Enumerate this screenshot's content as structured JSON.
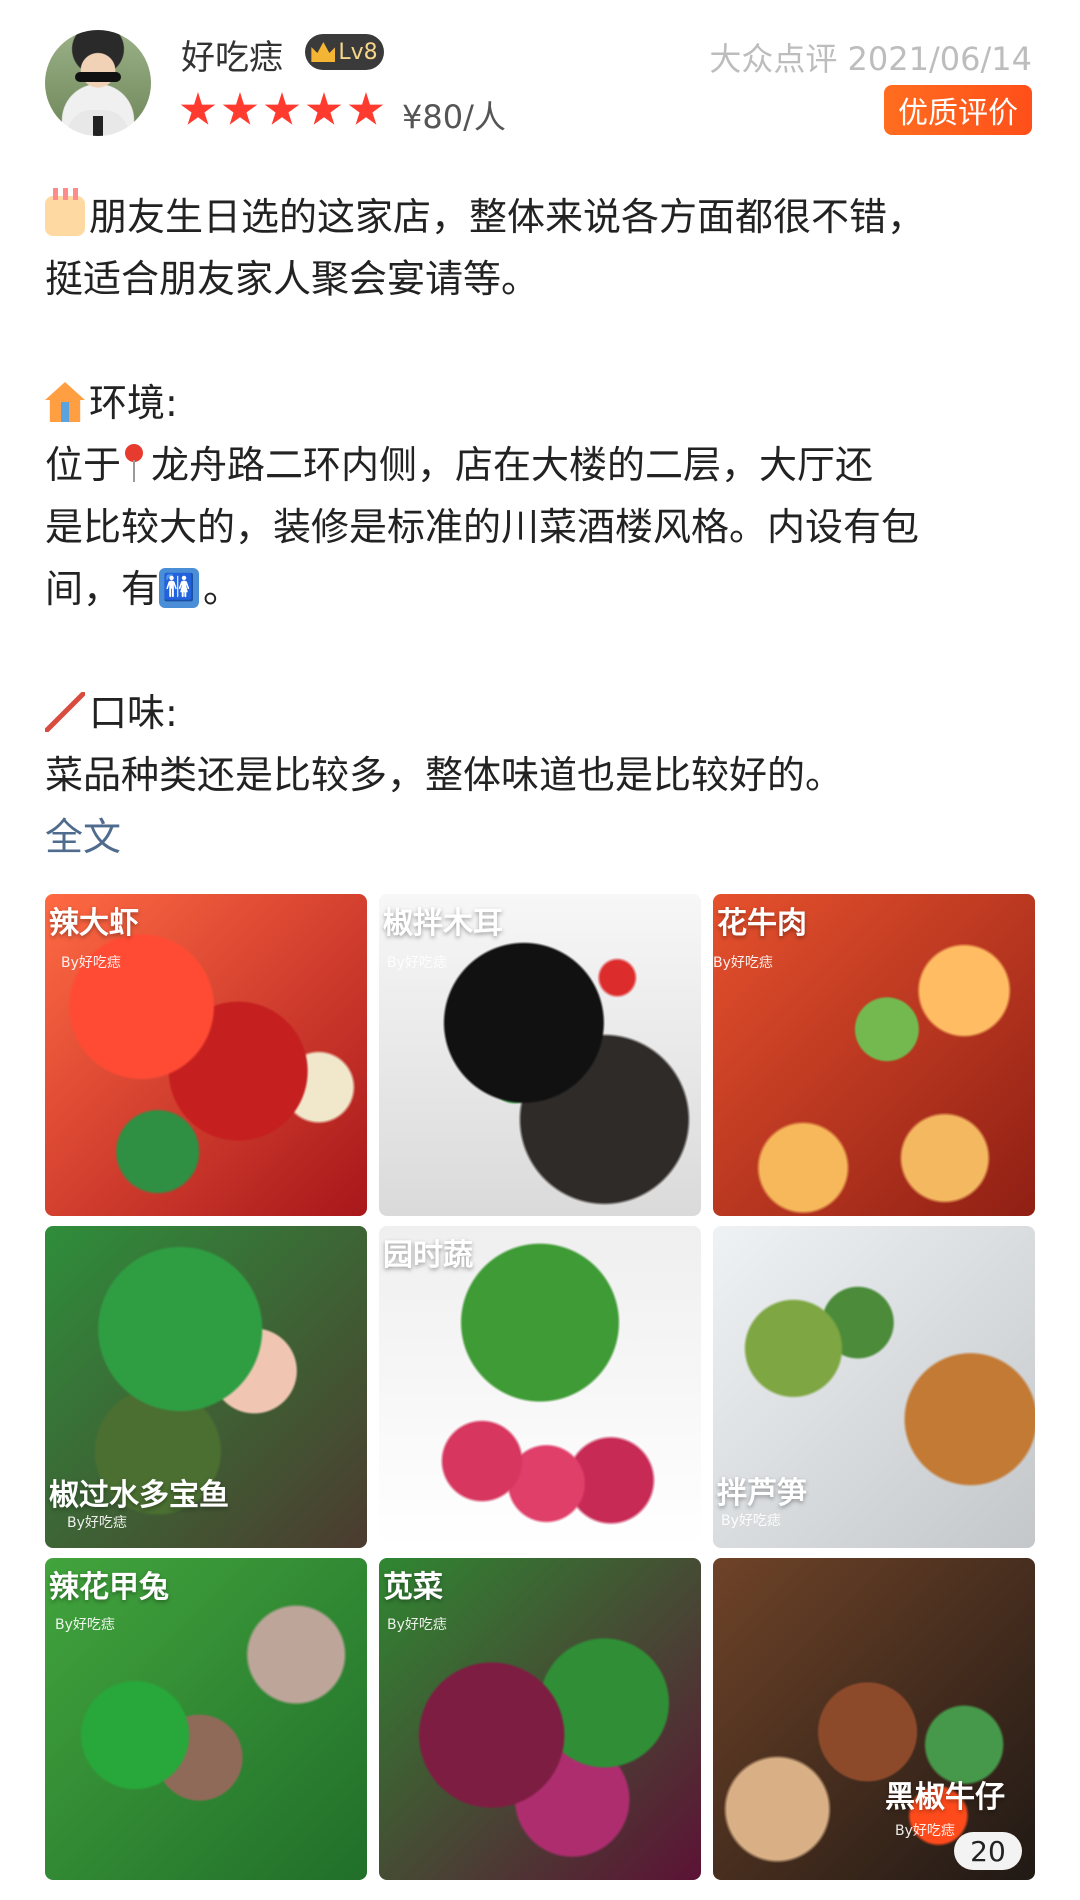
{
  "header": {
    "username": "好吃痣",
    "level": "Lv8",
    "rating": 5,
    "price": "¥80/人",
    "source_date": "大众点评 2021/06/14",
    "quality_badge": "优质评价"
  },
  "content": {
    "intro_line1": "朋友生日选的这家店，整体来说各方面都很不错，",
    "intro_line2": "挺适合朋友家人聚会宴请等。",
    "env_title": "环境:",
    "env_line1_a": "位于",
    "env_line1_b": "龙舟路二环内侧，店在大楼的二层，大厅还",
    "env_line2": "是比较大的，装修是标准的川菜酒楼风格。内设有包",
    "env_line3_a": "间，有",
    "env_line3_b": "。",
    "taste_title": "口味:",
    "taste_line1": "菜品种类还是比较多，整体味道也是比较好的。",
    "full_text_link": "全文"
  },
  "photos": {
    "items": [
      {
        "caption": "辣大虾",
        "signature": "By好吃痣"
      },
      {
        "caption": "椒拌木耳",
        "signature": "By好吃痣"
      },
      {
        "caption": "花牛肉",
        "signature": "By好吃痣"
      },
      {
        "caption": "椒过水多宝鱼",
        "signature": "By好吃痣"
      },
      {
        "caption": "园时蔬",
        "signature": ""
      },
      {
        "caption": "拌芦笋",
        "signature": "By好吃痣"
      },
      {
        "caption": "辣花甲兔",
        "signature": "By好吃痣"
      },
      {
        "caption": "苋菜",
        "signature": "By好吃痣"
      },
      {
        "caption": "黑椒牛仔",
        "signature": "By好吃痣"
      }
    ],
    "count": "20"
  },
  "colors": {
    "rating_star": "#ff3b30",
    "quality_badge_bg": "#ff5a1f",
    "link": "#4f6b8d"
  },
  "icons": {
    "crown": "crown-icon",
    "star": "star-icon",
    "cake": "birthday-cake-icon",
    "house": "house-icon",
    "pin": "location-pin-icon",
    "restroom": "restroom-icon",
    "chopsticks": "chopsticks-icon"
  }
}
